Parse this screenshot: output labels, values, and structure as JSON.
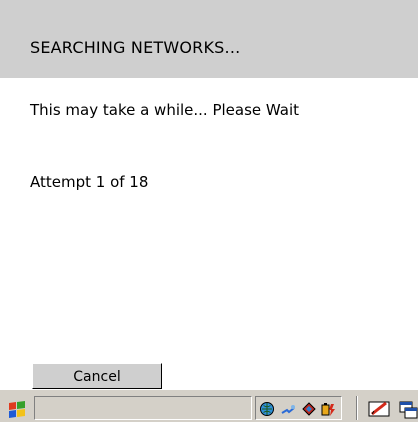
{
  "dialog": {
    "title": "SEARCHING NETWORKS...",
    "message": "This may take a while... Please Wait",
    "attempt_text": "Attempt 1 of 18",
    "cancel_label": "Cancel"
  },
  "taskbar": {
    "start_icon": "windows-flag-icon",
    "tray_icons": [
      "globe-network-icon",
      "wireless-signal-icon",
      "shield-icon",
      "battery-icon"
    ],
    "input_panel_icon": "pen-input-icon",
    "desktop_icon": "show-desktop-icon"
  },
  "colors": {
    "header_bg": "#cfcfcf",
    "taskbar_bg": "#d4d0c8"
  }
}
